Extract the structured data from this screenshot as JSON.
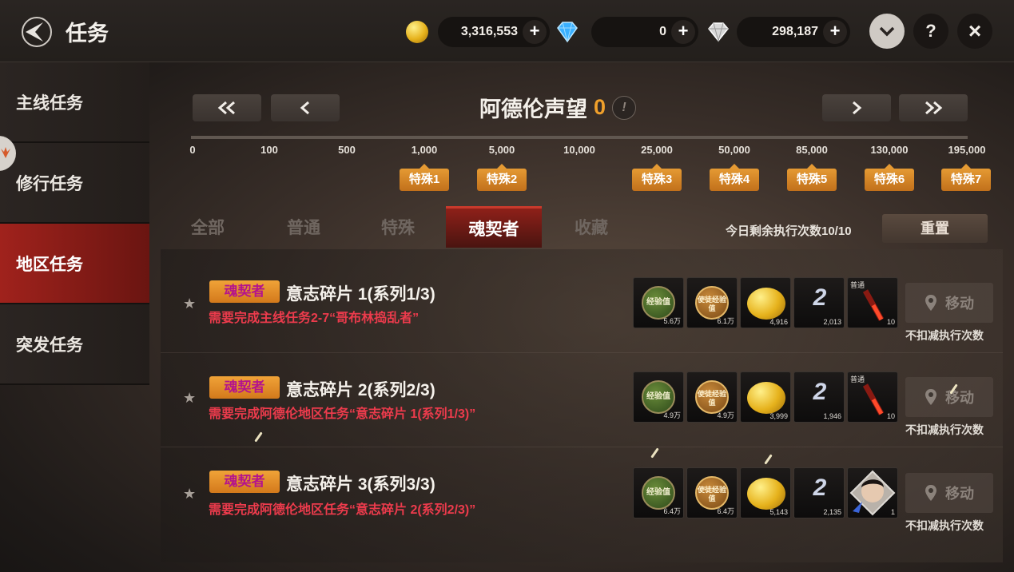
{
  "header": {
    "title": "任务",
    "gold": "3,316,553",
    "blue_gem": "0",
    "diamond": "298,187",
    "plus": "+",
    "help": "?",
    "close": "×"
  },
  "sidebar": {
    "items": [
      {
        "label": "主线任务"
      },
      {
        "label": "修行任务"
      },
      {
        "label": "地区任务"
      },
      {
        "label": "突发任务"
      }
    ]
  },
  "reputation": {
    "title": "阿德伦声望",
    "value": "0",
    "info": "!",
    "ticks": [
      "0",
      "100",
      "500",
      "1,000",
      "5,000",
      "10,000",
      "25,000",
      "50,000",
      "85,000",
      "130,000",
      "195,000"
    ],
    "specials": [
      "特殊1",
      "特殊2",
      "特殊3",
      "特殊4",
      "特殊5",
      "特殊6",
      "特殊7"
    ]
  },
  "tabs": [
    {
      "label": "全部"
    },
    {
      "label": "普通"
    },
    {
      "label": "特殊"
    },
    {
      "label": "魂契者"
    },
    {
      "label": "收藏"
    }
  ],
  "remaining": "今日剩余执行次数10/10",
  "reset_label": "重置",
  "quests": [
    {
      "badge": "魂契者",
      "title": "意志碎片 1(系列1/3)",
      "requirement": "需要完成主线任务2-7“哥布林捣乱者”",
      "rewards": {
        "exp": "5.6万",
        "disciple_exp": "6.1万",
        "gold": "4,916",
        "item": "2,013",
        "last": "10",
        "last_tag": "普通"
      },
      "move": "移动",
      "no_deduct": "不扣减执行次数"
    },
    {
      "badge": "魂契者",
      "title": "意志碎片 2(系列2/3)",
      "requirement": "需要完成阿德伦地区任务“意志碎片 1(系列1/3)”",
      "rewards": {
        "exp": "4.9万",
        "disciple_exp": "4.9万",
        "gold": "3,999",
        "item": "1,946",
        "last": "10",
        "last_tag": "普通"
      },
      "move": "移动",
      "no_deduct": "不扣减执行次数"
    },
    {
      "badge": "魂契者",
      "title": "意志碎片 3(系列3/3)",
      "requirement": "需要完成阿德伦地区任务“意志碎片 2(系列2/3)”",
      "rewards": {
        "exp": "6.4万",
        "disciple_exp": "6.4万",
        "gold": "5,143",
        "item": "2,135",
        "last": "1",
        "last_tag": ""
      },
      "move": "移动",
      "no_deduct": "不扣减执行次数"
    }
  ],
  "reward_icon_text": {
    "exp": "经验值",
    "disciple_exp": "使徒经验值",
    "roman": "2"
  }
}
